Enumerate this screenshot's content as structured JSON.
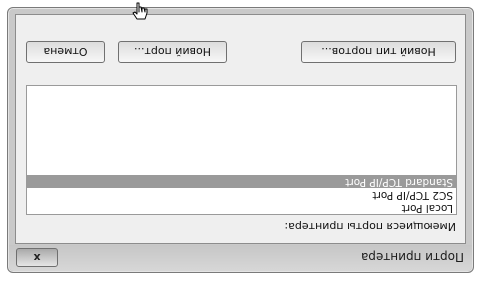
{
  "dialog": {
    "title": "Порти принтера",
    "close_label": "x"
  },
  "ports_label": "Имеющиеся порты принтера:",
  "ports": [
    {
      "label": "Local Port",
      "selected": false
    },
    {
      "label": "SC2 TCP/IP Port",
      "selected": false
    },
    {
      "label": "Standard TCP/IP Port",
      "selected": true
    }
  ],
  "buttons": {
    "new_port_type": "Новий тип портов...",
    "new_port": "Новий порт...",
    "cancel": "Отмена"
  },
  "pointer_icon": "hand-pointer-icon"
}
